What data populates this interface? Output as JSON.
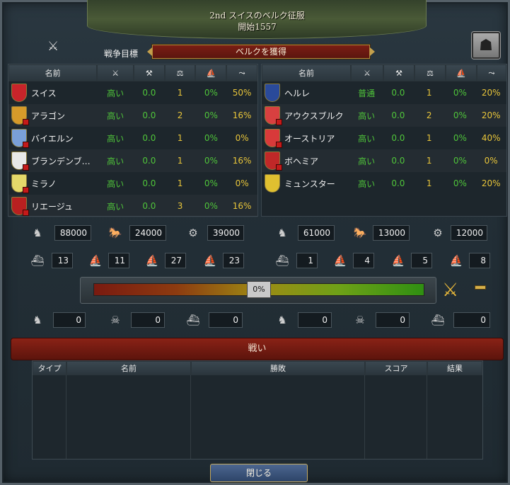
{
  "title": {
    "line1": "2nd スイスのベルク征服",
    "line2": "開始1557"
  },
  "wargoal": {
    "label": "戦争目標",
    "value": "ベルクを獲得"
  },
  "icons": {
    "top_left": "crossed-swords-icon",
    "settings": "advisor-portrait-icon",
    "war_score": "crossed-swords-gold-icon",
    "minus": "minus-icon"
  },
  "headers": [
    "名前",
    "crossed-weapons-icon",
    "axes-icon",
    "scales-icon",
    "fleet-icon",
    "musket-icon"
  ],
  "header_name": "名前",
  "attackers": [
    {
      "name": "スイス",
      "shield": "#c8242a",
      "dot": false,
      "c1": "高い",
      "c2": "0.0",
      "c3": "1",
      "c4": "0%",
      "c5": "50%"
    },
    {
      "name": "アラゴン",
      "shield": "#d69a2a",
      "dot": true,
      "c1": "高い",
      "c2": "0.0",
      "c3": "2",
      "c4": "0%",
      "c5": "16%"
    },
    {
      "name": "バイエルン",
      "shield": "#7aa0d8",
      "dot": true,
      "c1": "高い",
      "c2": "0.0",
      "c3": "1",
      "c4": "0%",
      "c5": "0%"
    },
    {
      "name": "ブランデンブ…",
      "shield": "#e8e8e8",
      "dot": true,
      "c1": "高い",
      "c2": "0.0",
      "c3": "1",
      "c4": "0%",
      "c5": "16%"
    },
    {
      "name": "ミラノ",
      "shield": "#e4d86a",
      "dot": true,
      "c1": "高い",
      "c2": "0.0",
      "c3": "1",
      "c4": "0%",
      "c5": "0%"
    },
    {
      "name": "リエージュ",
      "shield": "#b82020",
      "dot": true,
      "c1": "高い",
      "c2": "0.0",
      "c3": "3",
      "c4": "0%",
      "c5": "16%"
    }
  ],
  "defenders": [
    {
      "name": "ヘルレ",
      "shield": "#2a4a9a",
      "dot": false,
      "c1": "普通",
      "c2": "0.0",
      "c3": "1",
      "c4": "0%",
      "c5": "20%"
    },
    {
      "name": "アウクスブルク",
      "shield": "#d84040",
      "dot": true,
      "c1": "高い",
      "c2": "0.0",
      "c3": "2",
      "c4": "0%",
      "c5": "20%"
    },
    {
      "name": "オーストリア",
      "shield": "#d83a3a",
      "dot": true,
      "c1": "高い",
      "c2": "0.0",
      "c3": "1",
      "c4": "0%",
      "c5": "40%"
    },
    {
      "name": "ボヘミア",
      "shield": "#c02828",
      "dot": true,
      "c1": "高い",
      "c2": "0.0",
      "c3": "1",
      "c4": "0%",
      "c5": "0%"
    },
    {
      "name": "ミュンスター",
      "shield": "#e0c030",
      "dot": false,
      "c1": "高い",
      "c2": "0.0",
      "c3": "1",
      "c4": "0%",
      "c5": "20%"
    }
  ],
  "army": {
    "left": {
      "infantry": "88000",
      "cavalry": "24000",
      "artillery": "39000"
    },
    "right": {
      "infantry": "61000",
      "cavalry": "13000",
      "artillery": "12000"
    }
  },
  "navy": {
    "left": {
      "heavy": "13",
      "light": "11",
      "galley": "27",
      "transport": "23"
    },
    "right": {
      "heavy": "1",
      "light": "4",
      "galley": "5",
      "transport": "8"
    }
  },
  "war_score": {
    "value": "0%",
    "fraction": 0.5
  },
  "losses": {
    "left": {
      "land": "0",
      "attrition": "0",
      "naval": "0"
    },
    "right": {
      "land": "0",
      "attrition": "0",
      "naval": "0"
    }
  },
  "battles": {
    "title": "戦い",
    "columns": [
      "タイプ",
      "名前",
      "勝敗",
      "スコア",
      "結果"
    ]
  },
  "close_label": "閉じる"
}
